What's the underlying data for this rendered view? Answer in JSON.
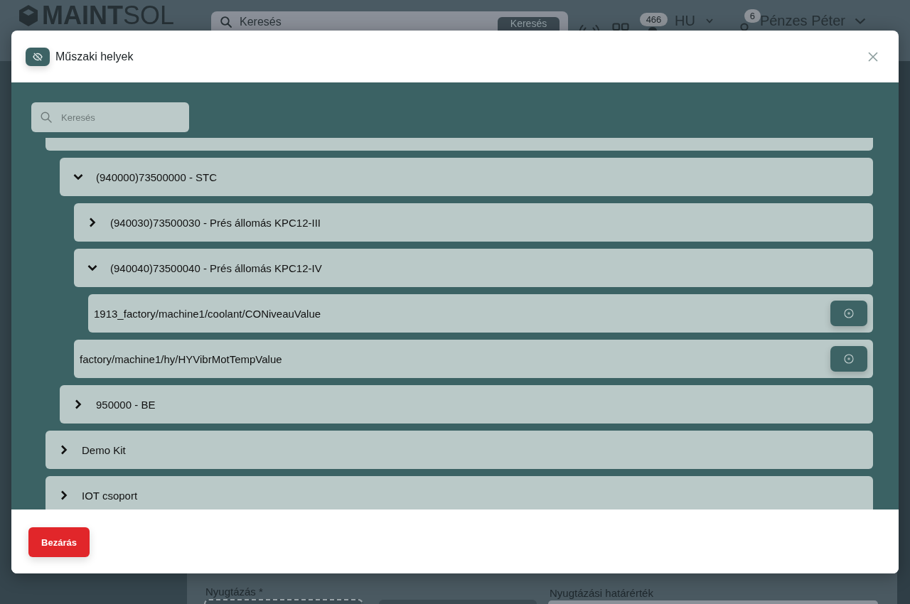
{
  "header": {
    "logo": "**MAINT**SOL",
    "search": {
      "placeholder": "Keresés",
      "button": "Keresés"
    },
    "notifications": {
      "badge": "466"
    },
    "language": {
      "label": "HU"
    },
    "user": {
      "badge": "6",
      "name": "Pénzes Péter"
    }
  },
  "modal": {
    "title": "Műszaki helyek",
    "search": {
      "placeholder": "Keresés"
    },
    "tree": [
      {
        "kind": "group",
        "expanded": true,
        "children": [
          {
            "kind": "group",
            "label": "(940000)73500000 - STC",
            "expanded": true,
            "children": [
              {
                "kind": "group",
                "label": "(940030)73500030 - Prés állomás KPC12-III",
                "expanded": false
              },
              {
                "kind": "group",
                "label": "(940040)73500040 - Prés állomás KPC12-IV",
                "expanded": true,
                "children": [
                  {
                    "kind": "point",
                    "label": "1913_factory/machine1/coolant/CONiveauValue"
                  }
                ]
              },
              {
                "kind": "point",
                "label": "factory/machine1/hy/HYVibrMotTempValue"
              }
            ]
          },
          {
            "kind": "group",
            "label": "950000 - BE",
            "expanded": false
          }
        ]
      },
      {
        "kind": "group",
        "label": "Demo Kit",
        "expanded": false
      },
      {
        "kind": "group",
        "label": "IOT csoport",
        "expanded": false
      }
    ],
    "close_button": "Bezárás"
  },
  "form": {
    "fields": [
      {
        "label": "Nyugtázás *",
        "kind": "dropzone"
      },
      {
        "kind": "select"
      },
      {
        "label": "Nyugtázási határérték",
        "kind": "input"
      }
    ]
  }
}
